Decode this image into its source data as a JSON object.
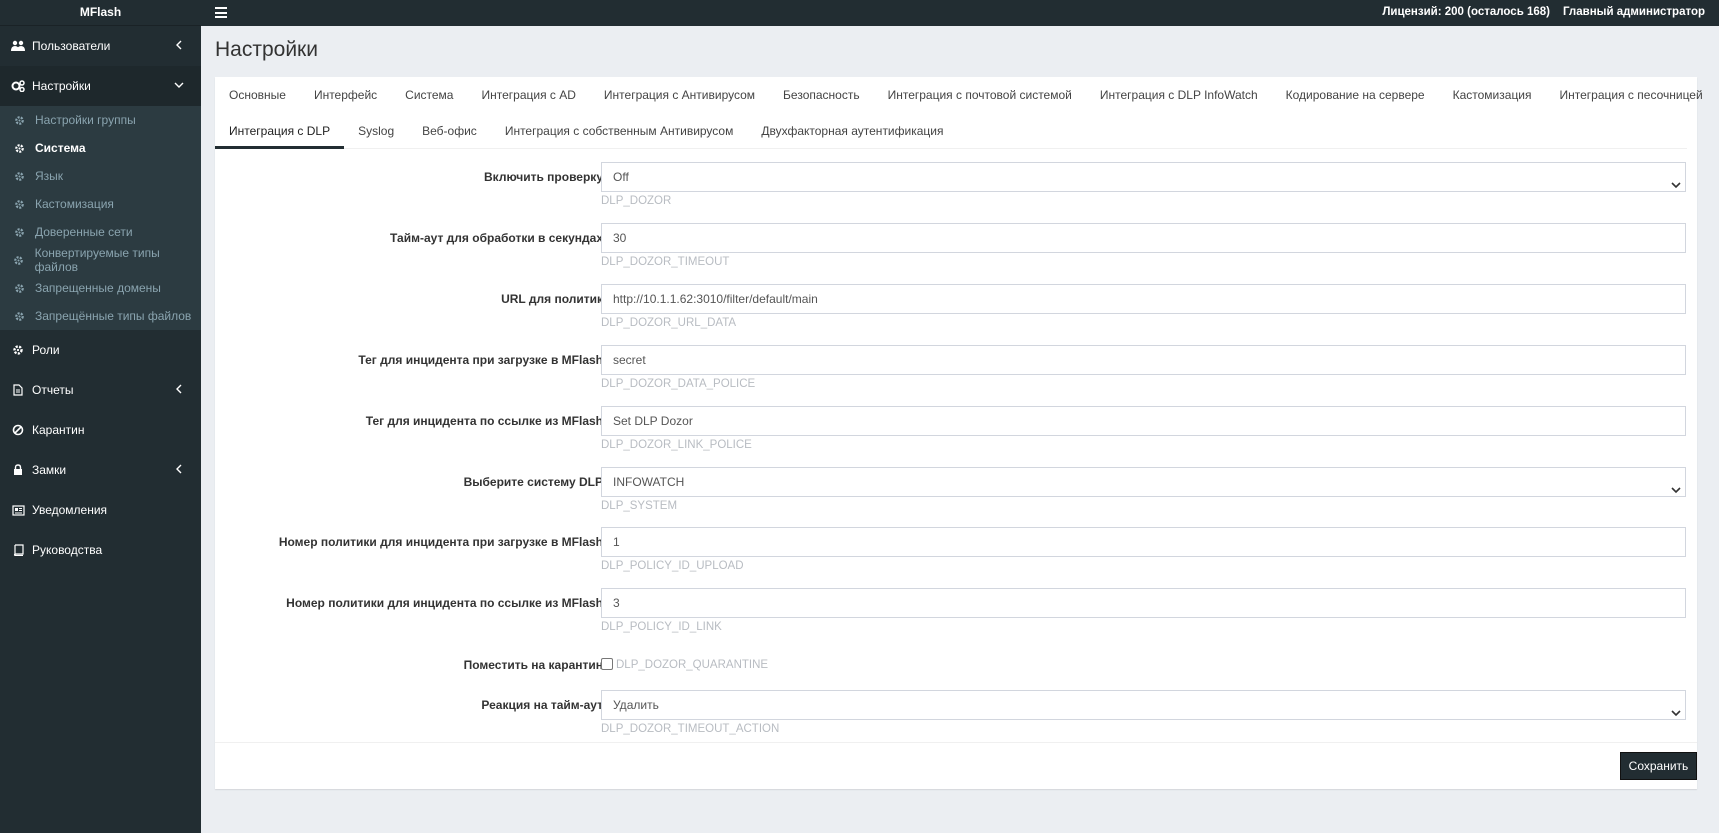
{
  "app": {
    "brand": "MFlash"
  },
  "topbar": {
    "license": "Лицензий: 200 (осталось 168)",
    "user": "Главный администратор"
  },
  "sidebar": {
    "items": [
      {
        "label": "Пользователи",
        "icon": "users-icon"
      },
      {
        "label": "Настройки",
        "icon": "cogs-icon"
      },
      {
        "label": "Роли",
        "icon": "gear-icon"
      },
      {
        "label": "Отчеты",
        "icon": "file-icon"
      },
      {
        "label": "Карантин",
        "icon": "ban-icon"
      },
      {
        "label": "Замки",
        "icon": "lock-icon"
      },
      {
        "label": "Уведомления",
        "icon": "newspaper-icon"
      },
      {
        "label": "Руководства",
        "icon": "book-icon"
      }
    ],
    "submenu": [
      {
        "label": "Настройки группы"
      },
      {
        "label": "Система"
      },
      {
        "label": "Язык"
      },
      {
        "label": "Кастомизация"
      },
      {
        "label": "Доверенные сети"
      },
      {
        "label": "Конвертируемые типы файлов"
      },
      {
        "label": "Запрещенные домены"
      },
      {
        "label": "Запрещённые типы файлов"
      }
    ]
  },
  "page": {
    "title": "Настройки"
  },
  "tabs": {
    "row1": [
      "Основные",
      "Интерфейс",
      "Система",
      "Интеграция с AD",
      "Интеграция с Антивирусом",
      "Безопасность",
      "Интеграция с почтовой системой",
      "Интеграция с DLP InfoWatch",
      "Кодирование на сервере",
      "Кастомизация",
      "Интеграция с песочницей"
    ],
    "row2": [
      "Интеграция с DLP",
      "Syslog",
      "Веб-офис",
      "Интеграция с собственным Антивирусом",
      "Двухфакторная аутентификация"
    ]
  },
  "form": {
    "enable": {
      "label": "Включить проверку",
      "value": "Off",
      "hint": "DLP_DOZOR"
    },
    "timeout": {
      "label": "Тайм-аут для обработки в секундах",
      "value": "30",
      "hint": "DLP_DOZOR_TIMEOUT"
    },
    "url": {
      "label": "URL для политик",
      "value": "http://10.1.1.62:3010/filter/default/main",
      "hint": "DLP_DOZOR_URL_DATA"
    },
    "tag_upload": {
      "label": "Тег для инцидента при загрузке в MFlash",
      "value": "secret",
      "hint": "DLP_DOZOR_DATA_POLICE"
    },
    "tag_link": {
      "label": "Тег для инцидента по ссылке из MFlash",
      "value": "Set DLP Dozor",
      "hint": "DLP_DOZOR_LINK_POLICE"
    },
    "system": {
      "label": "Выберите систему DLP",
      "value": "INFOWATCH",
      "hint": "DLP_SYSTEM"
    },
    "policy_upload": {
      "label": "Номер политики для инцидента при загрузке в MFlash",
      "value": "1",
      "hint": "DLP_POLICY_ID_UPLOAD"
    },
    "policy_link": {
      "label": "Номер политики для инцидента по ссылке из MFlash",
      "value": "3",
      "hint": "DLP_POLICY_ID_LINK"
    },
    "quarantine": {
      "label": "Поместить на карантин",
      "hint": "DLP_DOZOR_QUARANTINE",
      "checked": false
    },
    "timeout_action": {
      "label": "Реакция на тайм-аут",
      "value": "Удалить",
      "hint": "DLP_DOZOR_TIMEOUT_ACTION"
    }
  },
  "footer": {
    "save_label": "Сохранить"
  }
}
